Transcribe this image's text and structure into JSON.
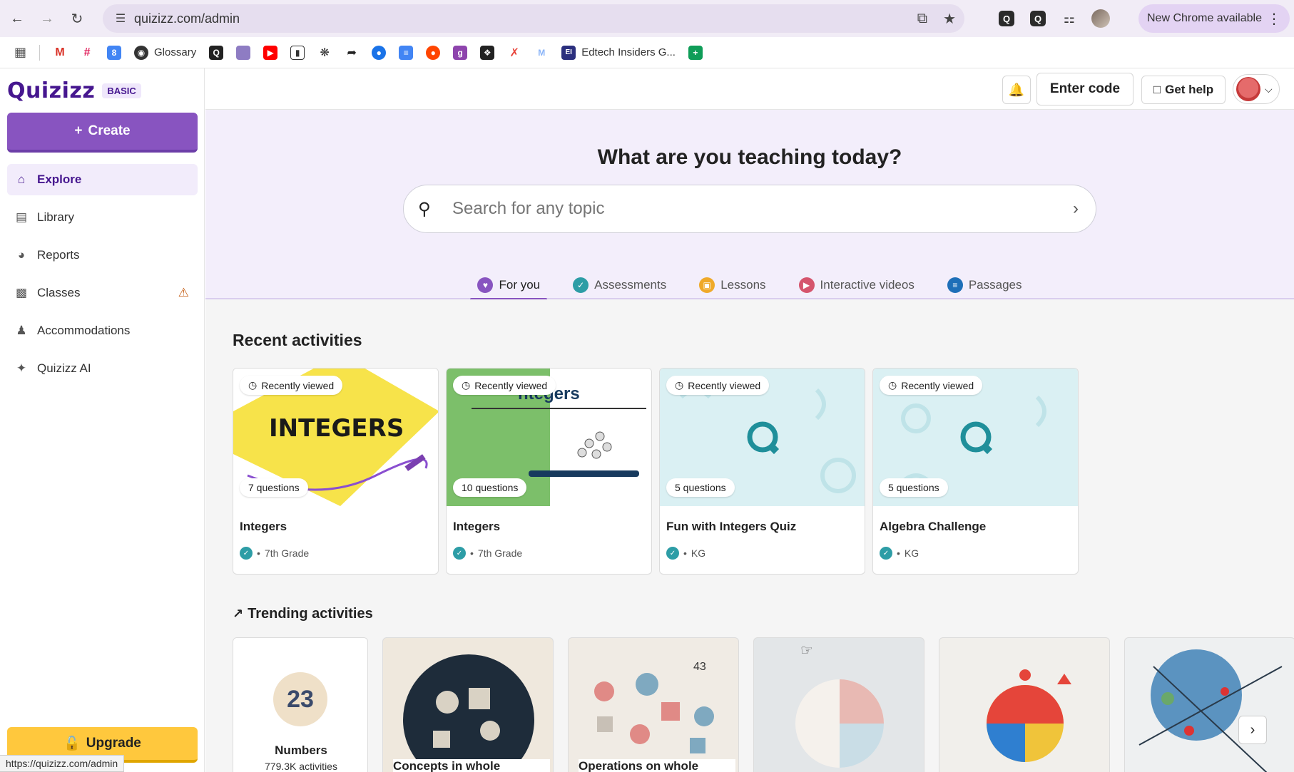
{
  "browser": {
    "url": "quizizz.com/admin",
    "new_chrome": "New Chrome available",
    "status_url": "https://quizizz.com/admin",
    "bookmarks": [
      {
        "label": "Glossary"
      },
      {
        "label": "Edtech Insiders G..."
      }
    ]
  },
  "sidebar": {
    "logo": "Quizizz",
    "plan_badge": "BASIC",
    "create_label": "Create",
    "items": [
      {
        "label": "Explore",
        "icon": "home-icon"
      },
      {
        "label": "Library",
        "icon": "library-icon"
      },
      {
        "label": "Reports",
        "icon": "reports-icon"
      },
      {
        "label": "Classes",
        "icon": "classes-icon"
      },
      {
        "label": "Accommodations",
        "icon": "accommodations-icon"
      },
      {
        "label": "Quizizz AI",
        "icon": "sparkle-icon"
      }
    ],
    "upgrade_label": "Upgrade"
  },
  "topbar": {
    "enter_code": "Enter code",
    "get_help": "Get help"
  },
  "hero": {
    "title": "What are you teaching today?",
    "search_placeholder": "Search for any topic",
    "tabs": [
      {
        "label": "For you",
        "color": "#8854c0"
      },
      {
        "label": "Assessments",
        "color": "#2d9da6"
      },
      {
        "label": "Lessons",
        "color": "#efa929"
      },
      {
        "label": "Interactive videos",
        "color": "#d5546d"
      },
      {
        "label": "Passages",
        "color": "#1e6fb8"
      }
    ]
  },
  "recent": {
    "title": "Recent activities",
    "cards": [
      {
        "badge": "Recently viewed",
        "questions": "7 questions",
        "title": "Integers",
        "grade": "7th Grade",
        "image_text": "INTEGERS"
      },
      {
        "badge": "Recently viewed",
        "questions": "10 questions",
        "title": "Integers",
        "grade": "7th Grade",
        "image_text": "ntegers"
      },
      {
        "badge": "Recently viewed",
        "questions": "5 questions",
        "title": "Fun with Integers Quiz",
        "grade": "KG"
      },
      {
        "badge": "Recently viewed",
        "questions": "5 questions",
        "title": "Algebra Challenge",
        "grade": "KG"
      }
    ]
  },
  "trending": {
    "title": "Trending activities",
    "cards": [
      {
        "title": "Numbers",
        "subtitle": "779.3K activities",
        "image_text": "23"
      },
      {
        "title": "Concepts in whole"
      },
      {
        "title": "Operations on whole",
        "image_text": "43"
      },
      {
        "title": ""
      },
      {
        "title": ""
      },
      {
        "title": ""
      }
    ]
  }
}
